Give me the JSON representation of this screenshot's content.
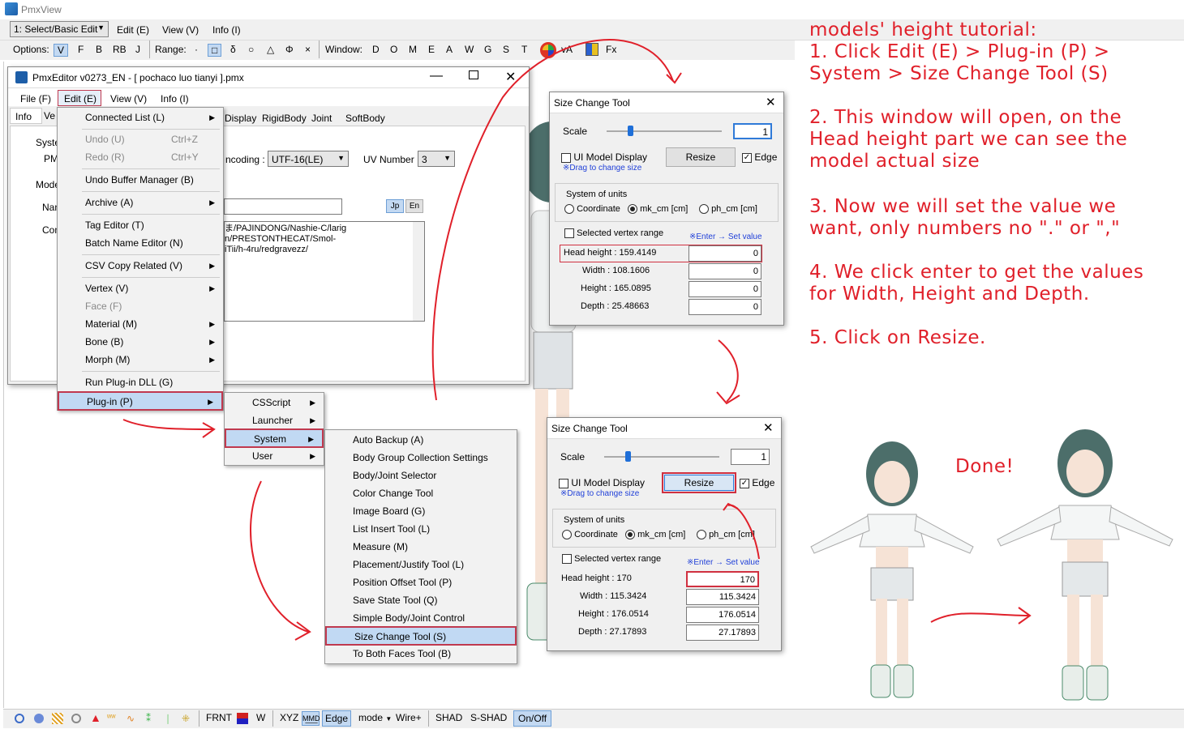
{
  "app": {
    "title": "PmxView"
  },
  "toolbar1": {
    "mode": "1: Select/Basic Edit",
    "menus": [
      "Edit (E)",
      "View (V)",
      "Info (I)"
    ]
  },
  "toolbar2": {
    "options_label": "Options:",
    "options": [
      "V",
      "F",
      "B",
      "RB",
      "J"
    ],
    "range_label": "Range:",
    "range": [
      "·",
      "□",
      "δ",
      "○",
      "△",
      "Φ",
      "×"
    ],
    "window_label": "Window:",
    "windows": [
      "D",
      "O",
      "M",
      "E",
      "A",
      "W",
      "G",
      "S",
      "T"
    ],
    "extra": [
      "vA",
      "Fx"
    ]
  },
  "editor": {
    "title": "PmxEditor v0273_EN - [ pochaco luo tianyi ].pmx",
    "menus": [
      "File (F)",
      "Edit (E)",
      "View (V)",
      "Info (I)"
    ],
    "tabs": [
      "Info",
      "Ve",
      "Display",
      "RigidBody",
      "Joint",
      "SoftBody"
    ],
    "system_label": "Syster",
    "pm_label": "PM",
    "model_label": "Mode",
    "name_label": "Nan",
    "comment_label": "Com",
    "encoding_label": "ncoding :",
    "encoding": "UTF-16(LE)",
    "uv_label": "UV Number :",
    "uv": "3",
    "lang": [
      "Jp",
      "En"
    ],
    "comment_lines": [
      "ま/PAJINDONG/Nashie-C/larig",
      "n/PRESTONTHECAT/Smol-",
      "iTii/h-4ru/redgravezz/"
    ]
  },
  "edit_menu": [
    {
      "label": "Connected List (L)",
      "arrow": true
    },
    {
      "label": "Undo (U)",
      "shortcut": "Ctrl+Z",
      "disabled": true
    },
    {
      "label": "Redo (R)",
      "shortcut": "Ctrl+Y",
      "disabled": true
    },
    {
      "label": "Undo Buffer Manager (B)"
    },
    {
      "label": "Archive (A)",
      "arrow": true
    },
    {
      "label": "Tag Editor (T)"
    },
    {
      "label": "Batch Name Editor (N)"
    },
    {
      "label": "CSV Copy Related (V)",
      "arrow": true
    },
    {
      "label": "Vertex (V)",
      "arrow": true
    },
    {
      "label": "Face (F)",
      "disabled": true
    },
    {
      "label": "Material (M)",
      "arrow": true
    },
    {
      "label": "Bone (B)",
      "arrow": true
    },
    {
      "label": "Morph (M)",
      "arrow": true
    },
    {
      "label": "Run Plug-in DLL (G)"
    },
    {
      "label": "Plug-in (P)",
      "arrow": true
    }
  ],
  "plugin_menu": [
    "CSScript",
    "Launcher",
    "System",
    "User"
  ],
  "system_menu": [
    "Auto Backup (A)",
    "Body Group Collection Settings",
    "Body/Joint Selector",
    "Color Change Tool",
    "Image Board (G)",
    "List Insert Tool (L)",
    "Measure (M)",
    "Placement/Justify Tool (L)",
    "Position Offset Tool (P)",
    "Save State Tool (Q)",
    "Simple Body/Joint Control",
    "Size Change Tool (S)",
    "To Both Faces Tool (B)"
  ],
  "size_tool_1": {
    "title": "Size Change Tool",
    "scale_label": "Scale",
    "scale": "1",
    "ui_model": "UI Model Display",
    "drag": "※Drag to change size",
    "resize": "Resize",
    "edge": "Edge",
    "units_label": "System of units",
    "units": [
      "Coordinate",
      "mk_cm [cm]",
      "ph_cm [cm]"
    ],
    "sel_range": "Selected vertex range",
    "enter": "※Enter → Set value",
    "rows": [
      {
        "label": "Head height : 159.4149",
        "value": "0"
      },
      {
        "label": "Width :   108.1606",
        "value": "0"
      },
      {
        "label": "Height :   165.0895",
        "value": "0"
      },
      {
        "label": "Depth :   25.48663",
        "value": "0"
      }
    ]
  },
  "size_tool_2": {
    "title": "Size Change Tool",
    "scale_label": "Scale",
    "scale": "1",
    "ui_model": "UI Model Display",
    "drag": "※Drag to change size",
    "resize": "Resize",
    "edge": "Edge",
    "units_label": "System of units",
    "units": [
      "Coordinate",
      "mk_cm [cm]",
      "ph_cm [cm]"
    ],
    "sel_range": "Selected vertex range",
    "enter": "※Enter → Set value",
    "rows": [
      {
        "label": "Head height :  170",
        "value": "170"
      },
      {
        "label": "Width :   115.3424",
        "value": "115.3424"
      },
      {
        "label": "Height :   176.0514",
        "value": "176.0514"
      },
      {
        "label": "Depth :   27.17893",
        "value": "27.17893"
      }
    ]
  },
  "tutorial": [
    "models' height tutorial:",
    "1. Click Edit (E) > Plug-in (P) >",
    "System > Size Change Tool (S)",
    "2. This window will open, on the",
    "Head height part we can see the",
    "model actual size",
    "3. Now we will set the value we",
    "want, only numbers no \".\" or \",\"",
    "4. We click enter to get the values",
    "for Width, Height and Depth.",
    "5. Click on Resize."
  ],
  "done": "Done!",
  "status": [
    "FRNT",
    "W",
    "XYZ",
    "Edge",
    "mode",
    "Wire+",
    "SHAD",
    "S-SHAD",
    "On/Off"
  ],
  "colors": {
    "accent_red": "#e0202a",
    "highlight": "#c1d9f3",
    "window_bg": "#f0f0f0"
  }
}
